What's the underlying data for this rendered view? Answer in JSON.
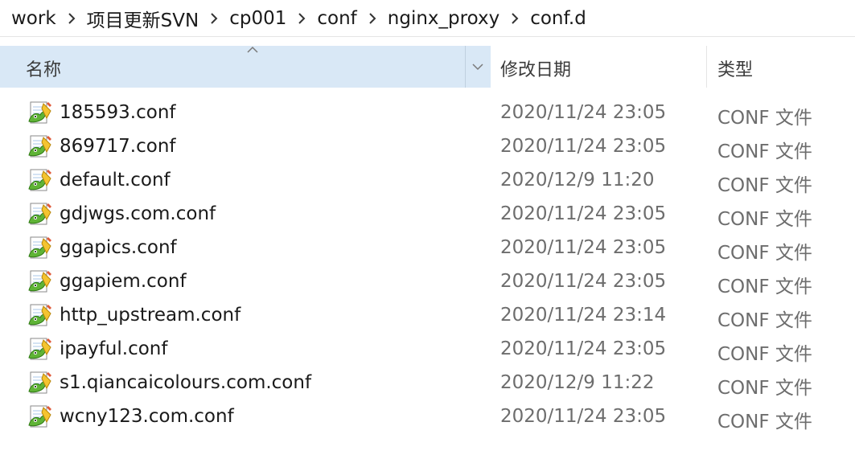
{
  "breadcrumb": {
    "items": [
      {
        "label": "work"
      },
      {
        "label": "项目更新SVN"
      },
      {
        "label": "cp001"
      },
      {
        "label": "conf"
      },
      {
        "label": "nginx_proxy"
      },
      {
        "label": "conf.d"
      }
    ]
  },
  "columns": {
    "name": "名称",
    "date_modified": "修改日期",
    "type": "类型"
  },
  "files": [
    {
      "name": "185593.conf",
      "date": "2020/11/24 23:05",
      "type": "CONF 文件"
    },
    {
      "name": "869717.conf",
      "date": "2020/11/24 23:05",
      "type": "CONF 文件"
    },
    {
      "name": "default.conf",
      "date": "2020/12/9 11:20",
      "type": "CONF 文件"
    },
    {
      "name": "gdjwgs.com.conf",
      "date": "2020/11/24 23:05",
      "type": "CONF 文件"
    },
    {
      "name": "ggapics.conf",
      "date": "2020/11/24 23:05",
      "type": "CONF 文件"
    },
    {
      "name": "ggapiem.conf",
      "date": "2020/11/24 23:05",
      "type": "CONF 文件"
    },
    {
      "name": "http_upstream.conf",
      "date": "2020/11/24 23:14",
      "type": "CONF 文件"
    },
    {
      "name": "ipayful.conf",
      "date": "2020/11/24 23:05",
      "type": "CONF 文件"
    },
    {
      "name": "s1.qiancaicolours.com.conf",
      "date": "2020/12/9 11:22",
      "type": "CONF 文件"
    },
    {
      "name": "wcny123.com.conf",
      "date": "2020/11/24 23:05",
      "type": "CONF 文件"
    }
  ],
  "icons": {
    "separator": "chevron-right-icon",
    "sort": "sort-ascending-icon",
    "dropdown": "chevron-down-icon",
    "file": "notepad-plus-plus-file-icon"
  },
  "colors": {
    "header_selected_bg": "#d9e8f6",
    "secondary_text": "#6d6d6d"
  }
}
